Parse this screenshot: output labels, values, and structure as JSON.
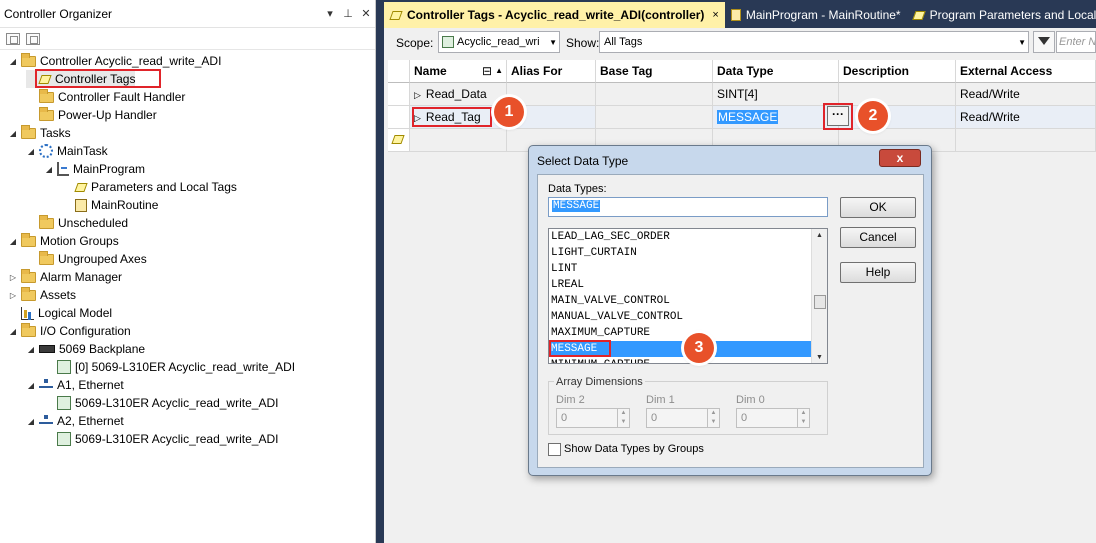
{
  "organizer": {
    "title": "Controller Organizer",
    "pin_icon": "pin-icon",
    "tree": [
      {
        "label": "Controller Acyclic_read_write_ADI",
        "icon": "folder-icon",
        "expand": "◢",
        "indent": 0
      },
      {
        "label": "Controller Tags",
        "icon": "tag-icon",
        "expand": "",
        "indent": 1
      },
      {
        "label": "Controller Fault Handler",
        "icon": "folder-icon",
        "expand": "",
        "indent": 1
      },
      {
        "label": "Power-Up Handler",
        "icon": "folder-icon",
        "expand": "",
        "indent": 1
      },
      {
        "label": "Tasks",
        "icon": "folder-icon",
        "expand": "◢",
        "indent": 0
      },
      {
        "label": "MainTask",
        "icon": "task-icon",
        "expand": "◢",
        "indent": 1
      },
      {
        "label": "MainProgram",
        "icon": "program-icon",
        "expand": "◢",
        "indent": 2
      },
      {
        "label": "Parameters and Local Tags",
        "icon": "tag-icon",
        "expand": "",
        "indent": 3
      },
      {
        "label": "MainRoutine",
        "icon": "routine-icon",
        "expand": "",
        "indent": 3
      },
      {
        "label": "Unscheduled",
        "icon": "folder-icon",
        "expand": "",
        "indent": 1
      },
      {
        "label": "Motion Groups",
        "icon": "folder-icon",
        "expand": "◢",
        "indent": 0
      },
      {
        "label": "Ungrouped Axes",
        "icon": "folder-icon",
        "expand": "",
        "indent": 1
      },
      {
        "label": "Alarm Manager",
        "icon": "folder-icon",
        "expand": "▷",
        "indent": 0
      },
      {
        "label": "Assets",
        "icon": "folder-icon",
        "expand": "▷",
        "indent": 0
      },
      {
        "label": "Logical Model",
        "icon": "chart-icon",
        "expand": "",
        "indent": 0
      },
      {
        "label": "I/O Configuration",
        "icon": "folder-icon",
        "expand": "◢",
        "indent": 0
      },
      {
        "label": "5069 Backplane",
        "icon": "backplane-icon",
        "expand": "◢",
        "indent": 1
      },
      {
        "label": "[0] 5069-L310ER Acyclic_read_write_ADI",
        "icon": "module-icon",
        "expand": "",
        "indent": 2
      },
      {
        "label": "A1, Ethernet",
        "icon": "network-icon",
        "expand": "◢",
        "indent": 1
      },
      {
        "label": "5069-L310ER Acyclic_read_write_ADI",
        "icon": "module-icon",
        "expand": "",
        "indent": 2
      },
      {
        "label": "A2, Ethernet",
        "icon": "network-icon",
        "expand": "◢",
        "indent": 1
      },
      {
        "label": "5069-L310ER Acyclic_read_write_ADI",
        "icon": "module-icon",
        "expand": "",
        "indent": 2
      }
    ]
  },
  "tabs": [
    {
      "label": "Controller Tags - Acyclic_read_write_ADI(controller)",
      "close": "×"
    },
    {
      "label": "MainProgram - MainRoutine*"
    },
    {
      "label": "Program Parameters and Local Ta"
    }
  ],
  "filter": {
    "scope_label": "Scope:",
    "scope_value": "Acyclic_read_wri",
    "show_label": "Show:",
    "show_value": "All Tags",
    "search_placeholder": "Enter Na"
  },
  "grid": {
    "columns": [
      "Name",
      "Alias For",
      "Base Tag",
      "Data Type",
      "Description",
      "External Access"
    ],
    "rows": [
      {
        "name": "Read_Data",
        "alias": "",
        "base": "",
        "type": "SINT[4]",
        "desc": "",
        "access": "Read/Write"
      },
      {
        "name": "Read_Tag",
        "alias": "",
        "base": "",
        "type": "MESSAGE",
        "desc": "",
        "access": "Read/Write"
      }
    ],
    "ellipsis": "···"
  },
  "dialog": {
    "title": "Select Data Type",
    "close": "x",
    "data_types_label": "Data Types:",
    "data_type_value": "MESSAGE",
    "list": [
      "LEAD_LAG_SEC_ORDER",
      "LIGHT_CURTAIN",
      "LINT",
      "LREAL",
      "MAIN_VALVE_CONTROL",
      "MANUAL_VALVE_CONTROL",
      "MAXIMUM_CAPTURE",
      "MESSAGE",
      "MINIMUM_CAPTURE"
    ],
    "selected": "MESSAGE",
    "ok": "OK",
    "cancel": "Cancel",
    "help": "Help",
    "array_dims_label": "Array Dimensions",
    "dims": [
      {
        "label": "Dim 2",
        "value": "0"
      },
      {
        "label": "Dim 1",
        "value": "0"
      },
      {
        "label": "Dim 0",
        "value": "0"
      }
    ],
    "show_groups_label": "Show Data Types by Groups"
  },
  "callouts": [
    "1",
    "2",
    "3"
  ],
  "colors": {
    "accent": "#293955",
    "active_tab": "#fff1a8",
    "callout": "#e8512a",
    "highlight_box": "#e0242a",
    "selection": "#3399ff"
  }
}
